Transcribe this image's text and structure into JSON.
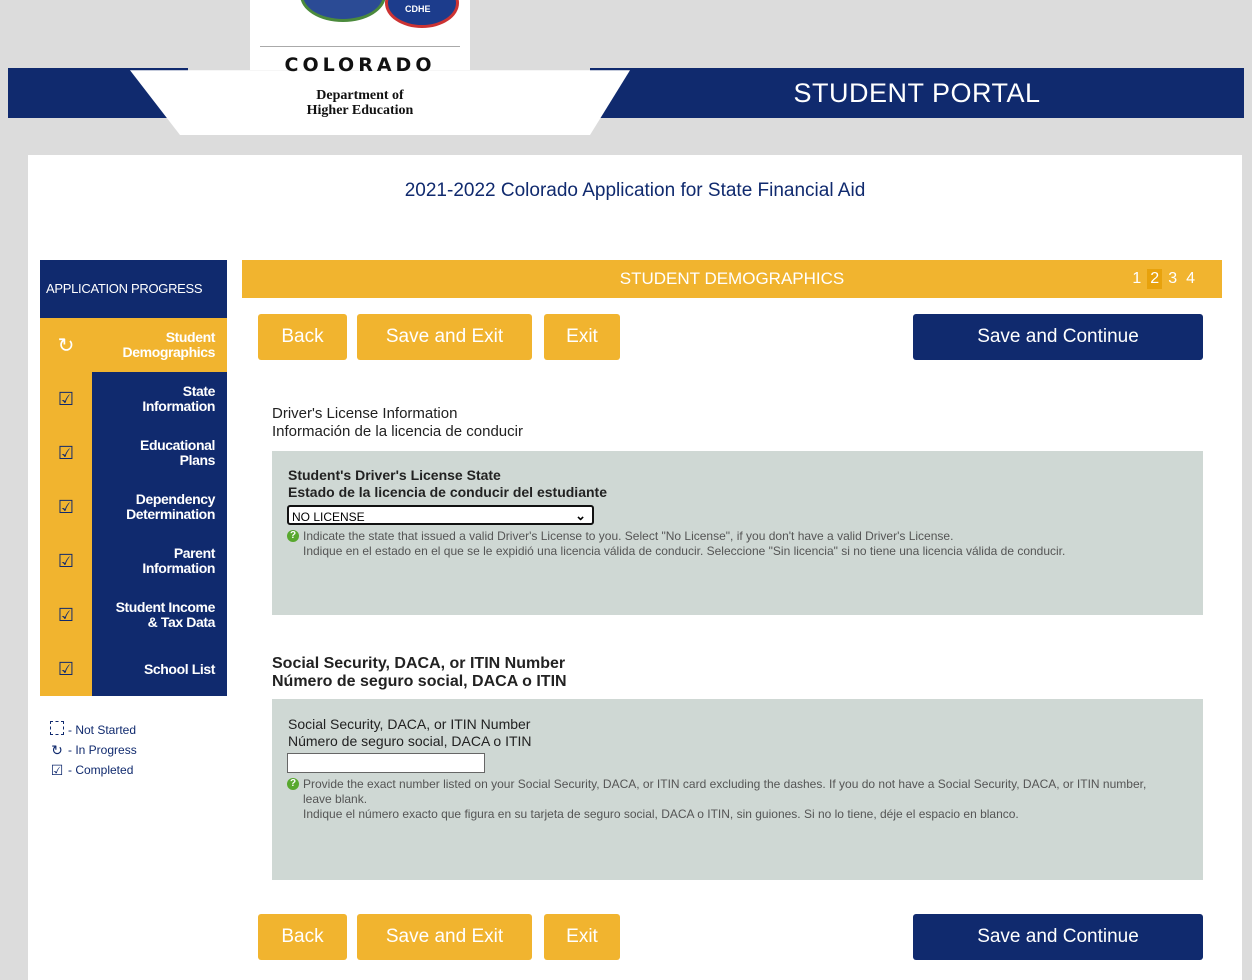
{
  "header": {
    "portal_title": "STUDENT PORTAL",
    "logo_state": "COLORADO",
    "logo_dept_line1": "Department of",
    "logo_dept_line2": "Higher Education",
    "logo_badge": "CDHE",
    "colors": {
      "navy": "#102a6e",
      "gold": "#f1b42f",
      "panel_gray": "#cfd8d4"
    }
  },
  "app_title": "2021-2022 Colorado Application for State Financial Aid",
  "sidebar": {
    "heading": "APPLICATION PROGRESS",
    "items": [
      {
        "label_l1": "Student",
        "label_l2": "Demographics",
        "status": "in-progress",
        "icon": "refresh-icon"
      },
      {
        "label_l1": "State",
        "label_l2": "Information",
        "status": "completed",
        "icon": "checkbox-checked-icon"
      },
      {
        "label_l1": "Educational",
        "label_l2": "Plans",
        "status": "completed",
        "icon": "checkbox-checked-icon"
      },
      {
        "label_l1": "Dependency",
        "label_l2": "Determination",
        "status": "completed",
        "icon": "checkbox-checked-icon"
      },
      {
        "label_l1": "Parent",
        "label_l2": "Information",
        "status": "completed",
        "icon": "checkbox-checked-icon"
      },
      {
        "label_l1": "Student Income",
        "label_l2": "& Tax Data",
        "status": "completed",
        "icon": "checkbox-checked-icon"
      },
      {
        "label_l1": "School List",
        "label_l2": "",
        "status": "completed",
        "icon": "checkbox-checked-icon"
      }
    ],
    "legend": [
      {
        "label": "- Not Started",
        "icon": "checkbox-empty-icon"
      },
      {
        "label": "- In Progress",
        "icon": "refresh-icon"
      },
      {
        "label": "- Completed",
        "icon": "checkbox-checked-icon"
      }
    ]
  },
  "section": {
    "title": "STUDENT DEMOGRAPHICS",
    "pages": [
      "1",
      "2",
      "3",
      "4"
    ],
    "current_page": "2"
  },
  "buttons": {
    "back": "Back",
    "save_exit": "Save and Exit",
    "exit": "Exit",
    "save_continue": "Save and Continue"
  },
  "drivers_license": {
    "heading_en": "Driver's License Information",
    "heading_es": "Información de la licencia de conducir",
    "field_label_en": "Student's Driver's License State",
    "field_label_es": "Estado de la licencia de conducir del estudiante",
    "selected_value": "NO LICENSE",
    "help_en": "Indicate the state that issued a valid Driver's License to you. Select \"No License\", if you don't have a valid Driver's License.",
    "help_es": "Indique en el estado en el que se le expidió una licencia válida de conducir. Seleccione \"Sin licencia\" si no tiene una licencia válida de conducir."
  },
  "ssn": {
    "heading_en": "Social Security, DACA, or ITIN Number",
    "heading_es": "Número de seguro social, DACA o ITIN",
    "field_label_en": "Social Security, DACA, or ITIN Number",
    "field_label_es": "Número de seguro social, DACA o ITIN",
    "value": "",
    "help_en": "Provide the exact number listed on your Social Security, DACA, or ITIN card excluding the dashes. If you do not have a Social Security, DACA, or ITIN number, leave blank.",
    "help_es": "Indique el número exacto que figura en su tarjeta de seguro social, DACA o ITIN, sin guiones. Si no lo tiene, déje el espacio en blanco."
  }
}
